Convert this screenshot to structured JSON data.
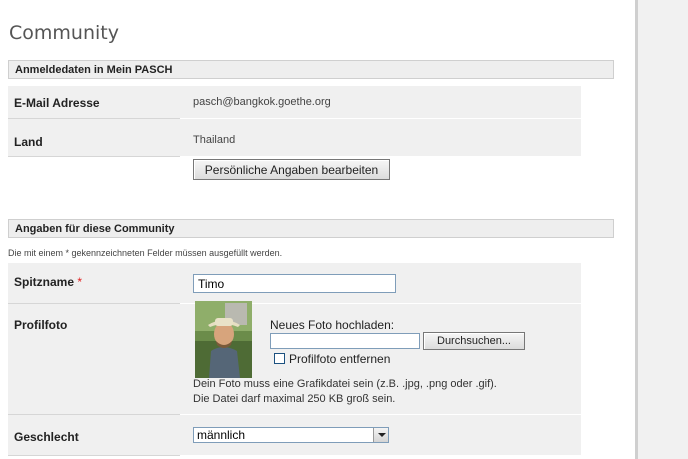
{
  "page": {
    "title": "Community"
  },
  "login_section": {
    "header": "Anmeldedaten in Mein PASCH",
    "email_label": "E-Mail Adresse",
    "email_value": "pasch@bangkok.goethe.org",
    "country_label": "Land",
    "country_value": "Thailand",
    "edit_button": "Persönliche Angaben bearbeiten"
  },
  "community_section": {
    "header": "Angaben für diese Community",
    "required_note": "Die mit einem * gekennzeichneten Felder müssen ausgefüllt werden.",
    "nickname_label": "Spitzname",
    "required_star": "*",
    "nickname_value": "Timo",
    "photo_label": "Profilfoto",
    "upload_label": "Neues Foto hochladen:",
    "file_value": "",
    "browse_button": "Durchsuchen...",
    "remove_photo_label": "Profilfoto entfernen",
    "remove_photo_checked": false,
    "photo_hint_line1": "Dein Foto muss eine Grafikdatei sein (z.B. .jpg, .png oder .gif).",
    "photo_hint_line2": "Die Datei darf maximal 250 KB groß sein.",
    "gender_label": "Geschlecht",
    "gender_selected": "männlich"
  },
  "colors": {
    "required_star": "#e02020",
    "row_background": "#f0f0f0",
    "right_panel": "#f1f1f1"
  }
}
